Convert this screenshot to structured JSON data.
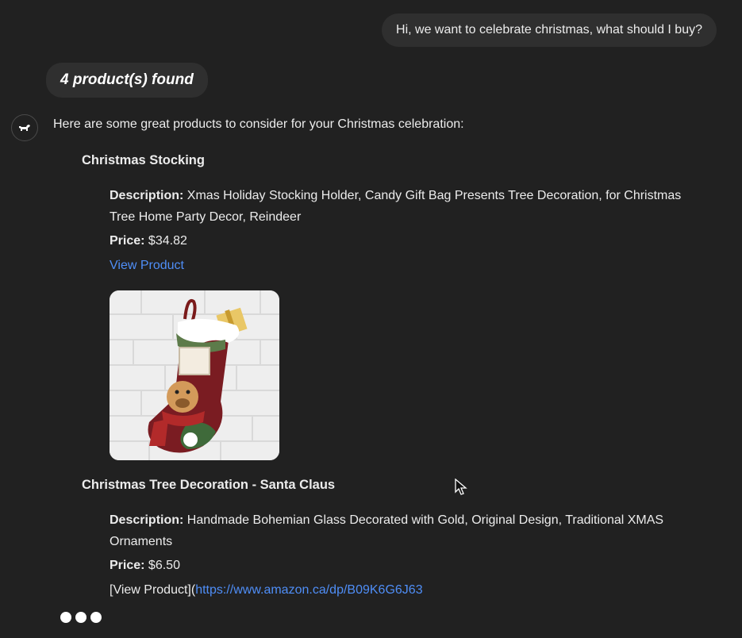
{
  "user_message": "Hi, we want to celebrate christmas, what should I buy?",
  "found_label": "4 product(s) found",
  "assistant": {
    "avatar_icon": "dog-icon",
    "intro": "Here are some great products to consider for your Christmas celebration:"
  },
  "desc_label": "Description:",
  "price_label": "Price:",
  "products": [
    {
      "title": "Christmas Stocking",
      "description": "Xmas Holiday Stocking Holder, Candy Gift Bag Presents Tree Decoration, for Christmas Tree Home Party Decor, Reindeer",
      "price": "$34.82",
      "link_text": "View Product",
      "image": "christmas-stocking-image"
    },
    {
      "title": "Christmas Tree Decoration - Santa Claus",
      "description": "Handmade Bohemian Glass Decorated with Gold, Original Design, Traditional XMAS Ornaments",
      "price": "$6.50",
      "raw_link_prefix": "[View Product](",
      "raw_link_url": "https://www.amazon.ca/dp/B09K6G6J63"
    }
  ],
  "colors": {
    "background": "#212121",
    "bubble": "#2f2f2f",
    "link": "#4f8ef7",
    "text": "#ececec"
  }
}
